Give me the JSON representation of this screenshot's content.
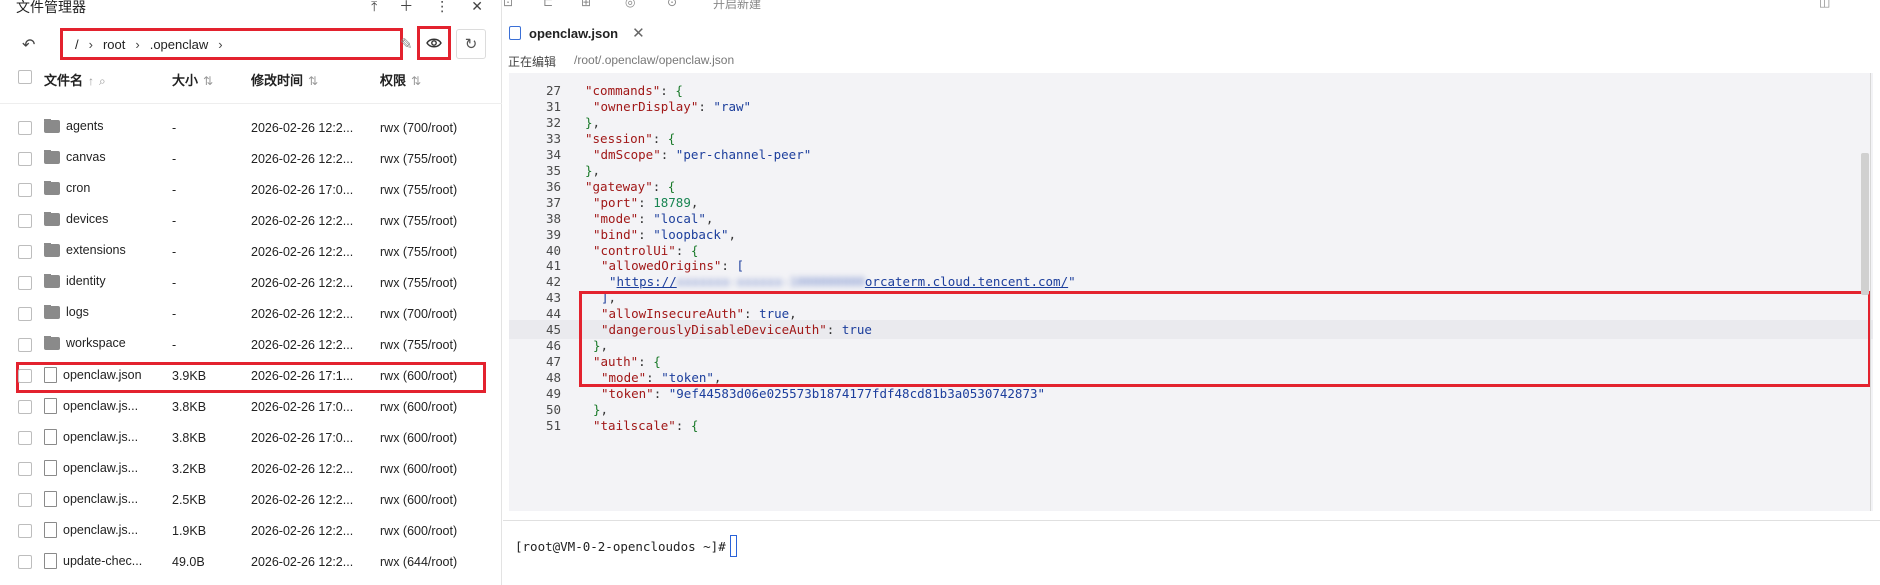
{
  "file_manager": {
    "title": "文件管理器",
    "path": [
      "/",
      "root",
      ".openclaw"
    ],
    "columns": {
      "name": "文件名",
      "size": "大小",
      "mtime": "修改时间",
      "perm": "权限"
    },
    "rows": [
      {
        "type": "folder",
        "name": "agents",
        "size": "-",
        "mtime": "2026-02-26 12:2...",
        "perm": "rwx  (700/root)"
      },
      {
        "type": "folder",
        "name": "canvas",
        "size": "-",
        "mtime": "2026-02-26 12:2...",
        "perm": "rwx  (755/root)"
      },
      {
        "type": "folder",
        "name": "cron",
        "size": "-",
        "mtime": "2026-02-26 17:0...",
        "perm": "rwx  (755/root)"
      },
      {
        "type": "folder",
        "name": "devices",
        "size": "-",
        "mtime": "2026-02-26 12:2...",
        "perm": "rwx  (755/root)"
      },
      {
        "type": "folder",
        "name": "extensions",
        "size": "-",
        "mtime": "2026-02-26 12:2...",
        "perm": "rwx  (755/root)"
      },
      {
        "type": "folder",
        "name": "identity",
        "size": "-",
        "mtime": "2026-02-26 12:2...",
        "perm": "rwx  (755/root)"
      },
      {
        "type": "folder",
        "name": "logs",
        "size": "-",
        "mtime": "2026-02-26 12:2...",
        "perm": "rwx  (700/root)"
      },
      {
        "type": "folder",
        "name": "workspace",
        "size": "-",
        "mtime": "2026-02-26 12:2...",
        "perm": "rwx  (755/root)"
      },
      {
        "type": "file",
        "name": "openclaw.json",
        "size": "3.9KB",
        "mtime": "2026-02-26 17:1...",
        "perm": "rwx  (600/root)",
        "highlight": true
      },
      {
        "type": "file",
        "name": "openclaw.js...",
        "size": "3.8KB",
        "mtime": "2026-02-26 17:0...",
        "perm": "rwx  (600/root)"
      },
      {
        "type": "file",
        "name": "openclaw.js...",
        "size": "3.8KB",
        "mtime": "2026-02-26 17:0...",
        "perm": "rwx  (600/root)"
      },
      {
        "type": "file",
        "name": "openclaw.js...",
        "size": "3.2KB",
        "mtime": "2026-02-26 12:2...",
        "perm": "rwx  (600/root)"
      },
      {
        "type": "file",
        "name": "openclaw.js...",
        "size": "2.5KB",
        "mtime": "2026-02-26 12:2...",
        "perm": "rwx  (600/root)"
      },
      {
        "type": "file",
        "name": "openclaw.js...",
        "size": "1.9KB",
        "mtime": "2026-02-26 12:2...",
        "perm": "rwx  (600/root)"
      },
      {
        "type": "file",
        "name": "update-chec...",
        "size": "49.0B",
        "mtime": "2026-02-26 12:2...",
        "perm": "rwx  (644/root)"
      }
    ]
  },
  "editor": {
    "tab_label": "openclaw.json",
    "status_label": "正在编辑",
    "file_path": "/root/.openclaw/openclaw.json",
    "toolbar_badge": "开启新建",
    "active_line": "45",
    "lines": [
      {
        "ln": "27",
        "indent": 1,
        "tokens": [
          [
            "k",
            "\"commands\""
          ],
          [
            "p",
            ": "
          ],
          [
            "pb",
            "{"
          ]
        ]
      },
      {
        "ln": "31",
        "indent": 2,
        "tokens": [
          [
            "k",
            "\"ownerDisplay\""
          ],
          [
            "p",
            ": "
          ],
          [
            "s",
            "\"raw\""
          ]
        ]
      },
      {
        "ln": "32",
        "indent": 1,
        "tokens": [
          [
            "pb",
            "}"
          ],
          [
            "p",
            ","
          ]
        ]
      },
      {
        "ln": "33",
        "indent": 1,
        "tokens": [
          [
            "k",
            "\"session\""
          ],
          [
            "p",
            ": "
          ],
          [
            "pb",
            "{"
          ]
        ]
      },
      {
        "ln": "34",
        "indent": 2,
        "tokens": [
          [
            "k",
            "\"dmScope\""
          ],
          [
            "p",
            ": "
          ],
          [
            "s",
            "\"per-channel-peer\""
          ]
        ]
      },
      {
        "ln": "35",
        "indent": 1,
        "tokens": [
          [
            "pb",
            "}"
          ],
          [
            "p",
            ","
          ]
        ]
      },
      {
        "ln": "36",
        "indent": 1,
        "tokens": [
          [
            "k",
            "\"gateway\""
          ],
          [
            "p",
            ": "
          ],
          [
            "pb",
            "{"
          ]
        ]
      },
      {
        "ln": "37",
        "indent": 2,
        "tokens": [
          [
            "k",
            "\"port\""
          ],
          [
            "p",
            ": "
          ],
          [
            "n",
            "18789"
          ],
          [
            "p",
            ","
          ]
        ]
      },
      {
        "ln": "38",
        "indent": 2,
        "tokens": [
          [
            "k",
            "\"mode\""
          ],
          [
            "p",
            ": "
          ],
          [
            "s",
            "\"local\""
          ],
          [
            "p",
            ","
          ]
        ]
      },
      {
        "ln": "39",
        "indent": 2,
        "tokens": [
          [
            "k",
            "\"bind\""
          ],
          [
            "p",
            ": "
          ],
          [
            "s",
            "\"loopback\""
          ],
          [
            "p",
            ","
          ]
        ]
      },
      {
        "ln": "40",
        "indent": 2,
        "tokens": [
          [
            "k",
            "\"controlUi\""
          ],
          [
            "p",
            ": "
          ],
          [
            "pb",
            "{"
          ]
        ]
      },
      {
        "ln": "41",
        "indent": 3,
        "tokens": [
          [
            "k",
            "\"allowedOrigins\""
          ],
          [
            "p",
            ": "
          ],
          [
            "s",
            "["
          ]
        ]
      },
      {
        "ln": "42",
        "indent": 4,
        "tokens": [
          [
            "s",
            "\""
          ],
          [
            "url",
            "https://"
          ],
          [
            "blur",
            "xxxxxxx-xxxxxx-1000000000"
          ],
          [
            "url",
            "orcaterm.cloud.tencent.com/"
          ],
          [
            "s",
            "\""
          ]
        ]
      },
      {
        "ln": "43",
        "indent": 3,
        "tokens": [
          [
            "s",
            "]"
          ],
          [
            "p",
            ","
          ]
        ]
      },
      {
        "ln": "44",
        "indent": 3,
        "tokens": [
          [
            "k",
            "\"allowInsecureAuth\""
          ],
          [
            "p",
            ": "
          ],
          [
            "b",
            "true"
          ],
          [
            "p",
            ","
          ]
        ]
      },
      {
        "ln": "45",
        "indent": 3,
        "tokens": [
          [
            "k",
            "\"dangerouslyDisableDeviceAuth\""
          ],
          [
            "p",
            ": "
          ],
          [
            "b",
            "true"
          ]
        ]
      },
      {
        "ln": "46",
        "indent": 2,
        "tokens": [
          [
            "pb",
            "}"
          ],
          [
            "p",
            ","
          ]
        ]
      },
      {
        "ln": "47",
        "indent": 2,
        "tokens": [
          [
            "k",
            "\"auth\""
          ],
          [
            "p",
            ": "
          ],
          [
            "pb",
            "{"
          ]
        ]
      },
      {
        "ln": "48",
        "indent": 3,
        "tokens": [
          [
            "k",
            "\"mode\""
          ],
          [
            "p",
            ": "
          ],
          [
            "s",
            "\"token\""
          ],
          [
            "p",
            ","
          ]
        ]
      },
      {
        "ln": "49",
        "indent": 3,
        "tokens": [
          [
            "k",
            "\"token\""
          ],
          [
            "p",
            ": "
          ],
          [
            "s",
            "\"9ef44583d06e025573b1874177fdf48cd81b3a0530742873\""
          ]
        ]
      },
      {
        "ln": "50",
        "indent": 2,
        "tokens": [
          [
            "pb",
            "}"
          ],
          [
            "p",
            ","
          ]
        ]
      },
      {
        "ln": "51",
        "indent": 2,
        "tokens": [
          [
            "k",
            "\"tailscale\""
          ],
          [
            "p",
            ": "
          ],
          [
            "pb",
            "{"
          ]
        ]
      }
    ]
  },
  "terminal": {
    "prompt": "[root@VM-0-2-opencloudos ~]#"
  },
  "colors": {
    "highlight_border": "#e3222e",
    "json_key": "#a11818",
    "json_string": "#1c3e9c",
    "json_number": "#198552"
  }
}
